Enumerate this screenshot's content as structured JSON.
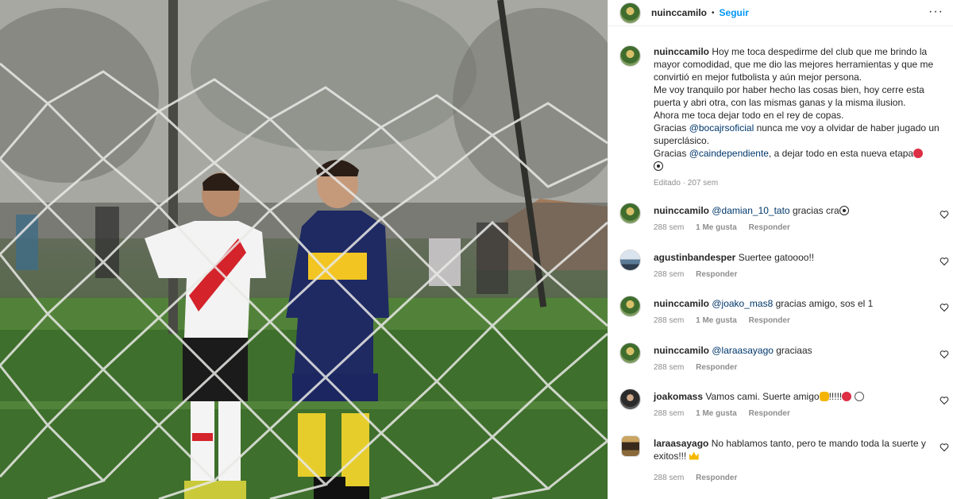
{
  "post": {
    "username": "nuinccamilo",
    "separator": "•",
    "follow_label": "Seguir",
    "more_label": "···",
    "photo_alt": "Foto del posteo"
  },
  "caption": {
    "username": "nuinccamilo",
    "line1": "Hoy me toca despedirme del club que me brindo la mayor comodidad, que me dio las mejores herramientas y que me convirtió en mejor futbolista y aún mejor persona.",
    "line2": "Me voy tranquilo por haber hecho las cosas bien, hoy cerre esta puerta y abri otra, con las mismas ganas y la misma ilusion.",
    "line3": "Ahora me toca dejar todo en el rey de copas.",
    "line4_pre": "Gracias ",
    "line4_mention": "@bocajrsoficial",
    "line4_post": " nunca me voy a olvidar de haber jugado un superclásico.",
    "line5_pre": "Gracias ",
    "line5_mention": "@caindependiente",
    "line5_post": ", a dejar todo en esta nueva etapa",
    "meta": "Editado · 207 sem"
  },
  "comments": [
    {
      "username": "nuinccamilo",
      "mention": "@damian_10_tato",
      "text": " gracias cra",
      "emojis": [
        "soccer-ball"
      ],
      "time": "288 sem",
      "likes": "1 Me gusta",
      "reply": "Responder"
    },
    {
      "username": "agustinbandesper",
      "mention": "",
      "text": "Suertee gatoooo!!",
      "emojis": [],
      "time": "288 sem",
      "likes": "",
      "reply": "Responder"
    },
    {
      "username": "nuinccamilo",
      "mention": "@joako_mas8",
      "text": " gracias amigo, sos el 1",
      "emojis": [],
      "time": "288 sem",
      "likes": "1 Me gusta",
      "reply": "Responder"
    },
    {
      "username": "nuinccamilo",
      "mention": "@laraasayago",
      "text": " graciaas",
      "emojis": [],
      "time": "288 sem",
      "likes": "",
      "reply": "Responder"
    },
    {
      "username": "joakomass",
      "mention": "",
      "text": "Vamos cami. Suerte amigo",
      "text_after": "!!!!!",
      "emojis": [
        "clapping-hands",
        "red-circle",
        "white-circle"
      ],
      "time": "288 sem",
      "likes": "1 Me gusta",
      "reply": "Responder"
    },
    {
      "username": "laraasayago",
      "mention": "",
      "text": "No hablamos tanto, pero te mando toda la suerte y exitos!!! ",
      "emojis": [
        "crown"
      ],
      "time": "288 sem",
      "likes": "",
      "reply": "Responder"
    }
  ],
  "icons": {
    "heart": "heart-outline-icon",
    "more": "ellipsis-icon"
  },
  "colors": {
    "link": "#0095f6",
    "mention": "#00376b",
    "meta": "#8e8e8e",
    "text": "#262626"
  }
}
